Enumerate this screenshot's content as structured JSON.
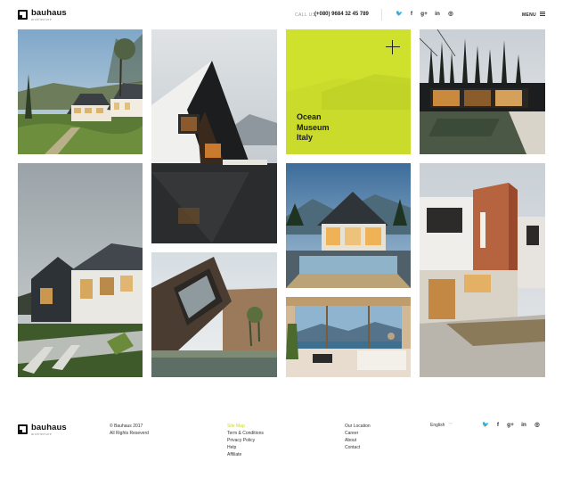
{
  "header": {
    "logo": {
      "name": "bauhaus",
      "tagline": "architecture"
    },
    "call_label": "CALL US:",
    "phone": "(+080) 9684 32 45 789",
    "social": [
      {
        "icon": "twitter-icon",
        "glyph": "🐦",
        "color": "#c7d92a"
      },
      {
        "icon": "facebook-icon",
        "glyph": "f",
        "color": "#333333"
      },
      {
        "icon": "google-plus-icon",
        "glyph": "g+",
        "color": "#333333"
      },
      {
        "icon": "linkedin-icon",
        "glyph": "in",
        "color": "#333333"
      },
      {
        "icon": "dribbble-icon",
        "glyph": "◎",
        "color": "#333333"
      }
    ],
    "menu_label": "MENU"
  },
  "gallery": {
    "featured": {
      "title": "Ocean\nMuseum\nItaly",
      "background": "#cfe02d"
    }
  },
  "footer": {
    "logo": {
      "name": "bauhaus",
      "tagline": "architecture"
    },
    "copyright": "© Bauhaus 2017",
    "rights": "All Rights Reseverd",
    "links_a": [
      "Site Map",
      "Term & Conditions",
      "Privacy Policy",
      "Help",
      "Affiliate"
    ],
    "links_b": [
      "Our Location",
      "Career",
      "About",
      "Contact"
    ],
    "language": "English",
    "social": [
      {
        "icon": "twitter-icon",
        "glyph": "🐦",
        "color": "#c7d92a"
      },
      {
        "icon": "facebook-icon",
        "glyph": "f",
        "color": "#333333"
      },
      {
        "icon": "google-plus-icon",
        "glyph": "g+",
        "color": "#333333"
      },
      {
        "icon": "linkedin-icon",
        "glyph": "in",
        "color": "#333333"
      },
      {
        "icon": "dribbble-icon",
        "glyph": "◎",
        "color": "#333333"
      }
    ],
    "accent_color": "#c7d92a"
  }
}
